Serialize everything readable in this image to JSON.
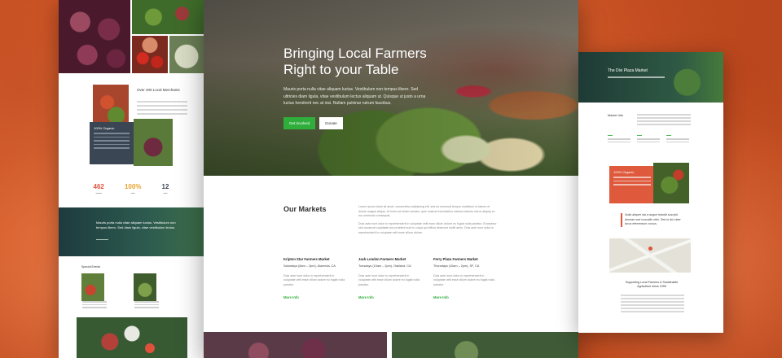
{
  "hero": {
    "title": "Bringing Local Farmers Right to your Table",
    "text": "Mauris porta nulla vitae aliquam luctus. Vestibulum non tempus libero. Sed ultricies diam ligula, vitae vestibulum lectus aliquam ut. Quisque ut justo a urna luctus hendrerit nec at nisi. Nullam pulvinar rutrum faucibus.",
    "primary_button": "Get Involved",
    "secondary_button": "Donate"
  },
  "markets": {
    "title": "Our Markets",
    "intro_1": "Lorem ipsum dolor sit amet, consectetur adipiscing elit, sed do eiusmod tempor incididunt ut labore et dolore magna aliqua. Ut enim ad minim veniam, quis nostrud exercitation ullamco laboris nisi ut aliquip ex ea commodo consequat.",
    "intro_2": "Duis aute irure dolor in reprehenderit in voluptate velit esse cillum dolore eu fugiat nulla pariatur. Excepteur sint occaecat cupidatat non proident sunt in culpa qui officia deserunt mollit anim. Duis aute irure dolor in reprehenderit in voluptate velit esse cillum dolore.",
    "items": [
      {
        "name": "Kripton Star Farmers Market",
        "time": "Saturdays (8am – 2pm), Alameda, CA",
        "desc": "Duis aute irure dolor in reprehenderit in voluptate velit esse cillum dolore eu fugiat nulla pariatur.",
        "more": "More Info"
      },
      {
        "name": "Jack London Farmers Market",
        "time": "Tuesdays (10am – 2pm), Oakland, CA",
        "desc": "Duis aute irure dolor in reprehenderit in voluptate velit esse cillum dolore eu fugiat nulla pariatur.",
        "more": "More Info"
      },
      {
        "name": "Ferry Plaza Farmers Market",
        "time": "Thursdays (10am – 2pm), SF, CA",
        "desc": "Duis aute irure dolor in reprehenderit in voluptate velit esse cillum dolore eu fugiat nulla pariatur.",
        "more": "More Info"
      }
    ]
  },
  "left_page": {
    "merchants_title": "Over 400 Local Merchants",
    "more_link": "Learn More",
    "organic_title": "100% Organic",
    "stats": [
      {
        "value": "462",
        "color": "#e0513b"
      },
      {
        "value": "100%",
        "color": "#e8a02a"
      },
      {
        "value": "12",
        "color": "#3b4654"
      }
    ],
    "banner_quote": "Mauris porta nulla vitae aliquam luctus. Vestibulum non tempus libero. Sed diam ligula, vitae vestibulum lectus.",
    "events_title": "Special Events"
  },
  "right_page": {
    "header_title": "The Divi Plaza Market",
    "info_title": "Market Info",
    "organic_title": "100% Organic",
    "quote": "Nulla aliquet nisl a augue blandit suscipit. Aenean sed convallis nibh. Sed ut dui vitae lacus elementum cursus.",
    "support_title": "Supporting Local Farmers & Sustainable Agriculture since 1995"
  },
  "colors": {
    "accent_green": "#2fae3b",
    "accent_red": "#df5a3d",
    "background_orange": "#d35a28"
  }
}
